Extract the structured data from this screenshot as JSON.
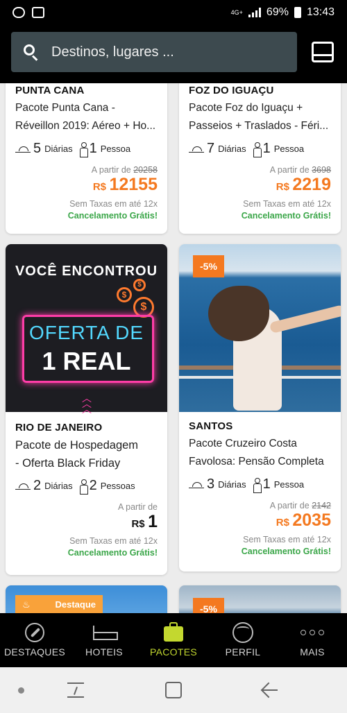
{
  "status_bar": {
    "network": "4G+",
    "battery_percent": "69%",
    "time": "13:43"
  },
  "search": {
    "placeholder": "Destinos, lugares ..."
  },
  "cards": [
    {
      "destination": "PUNTA CANA",
      "title_line1": "Pacote Punta Cana -",
      "title_line2": "Réveillon 2019: Aéreo + Ho...",
      "nights": "5",
      "nights_label": "Diárias",
      "people": "1",
      "people_label": "Pessoa",
      "from_label": "A partir de",
      "old_price": "20258",
      "currency": "R$",
      "price": "12155",
      "taxes": "Sem Taxas em até 12x",
      "cancellation": "Cancelamento Grátis!"
    },
    {
      "destination": "FOZ DO IGUAÇU",
      "title_line1": "Pacote Foz do Iguaçu +",
      "title_line2": "Passeios + Traslados - Féri...",
      "nights": "7",
      "nights_label": "Diárias",
      "people": "1",
      "people_label": "Pessoa",
      "from_label": "A partir de",
      "old_price": "3698",
      "currency": "R$",
      "price": "2219",
      "taxes": "Sem Taxas em até 12x",
      "cancellation": "Cancelamento Grátis!"
    },
    {
      "promo_top": "VOCÊ ENCONTROU",
      "promo_line1": "OFERTA DE",
      "promo_line2": "1 REAL",
      "destination": "RIO DE JANEIRO",
      "title_line1": "Pacote de Hospedagem",
      "title_line2": "- Oferta Black Friday",
      "nights": "2",
      "nights_label": "Diárias",
      "people": "2",
      "people_label": "Pessoas",
      "from_label": "A partir de",
      "currency": "R$",
      "price": "1",
      "taxes": "Sem Taxas em até 12x",
      "cancellation": "Cancelamento Grátis!"
    },
    {
      "badge": "-5%",
      "destination": "SANTOS",
      "title_line1": "Pacote Cruzeiro Costa",
      "title_line2": "Favolosa: Pensão Completa",
      "nights": "3",
      "nights_label": "Diárias",
      "people": "1",
      "people_label": "Pessoa",
      "from_label": "A partir de",
      "old_price": "2142",
      "currency": "R$",
      "price": "2035",
      "taxes": "Sem Taxas em até 12x",
      "cancellation": "Cancelamento Grátis!"
    },
    {
      "badge": "Destaque"
    },
    {
      "badge": "-5%"
    }
  ],
  "bottom_nav": [
    {
      "label": "DESTAQUES",
      "icon": "compass-icon"
    },
    {
      "label": "HOTEIS",
      "icon": "bed-icon"
    },
    {
      "label": "PACOTES",
      "icon": "suitcase-icon",
      "active": true
    },
    {
      "label": "PERFIL",
      "icon": "profile-icon"
    },
    {
      "label": "MAIS",
      "icon": "more-icon"
    }
  ],
  "colors": {
    "accent_orange": "#f47920",
    "accent_green": "#3aa648",
    "nav_active": "#c3d82f",
    "header_bg": "#000000",
    "search_bg": "#3d4a4f"
  }
}
